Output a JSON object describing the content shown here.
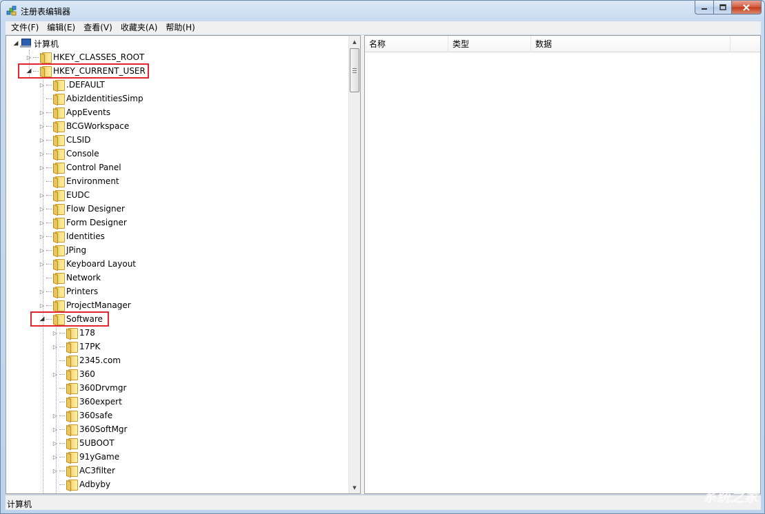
{
  "window": {
    "title": "注册表编辑器"
  },
  "menubar": {
    "items": [
      "文件(F)",
      "编辑(E)",
      "查看(V)",
      "收藏夹(A)",
      "帮助(H)"
    ]
  },
  "tree": {
    "root": "计算机",
    "hkcr": "HKEY_CLASSES_ROOT",
    "hkcu": "HKEY_CURRENT_USER",
    "hkcu_children": [
      ".DEFAULT",
      "AbizIdentitiesSimp",
      "AppEvents",
      "BCGWorkspace",
      "CLSID",
      "Console",
      "Control Panel",
      "Environment",
      "EUDC",
      "Flow Designer",
      "Form Designer",
      "Identities",
      "JPing",
      "Keyboard Layout",
      "Network",
      "Printers",
      "ProjectManager",
      "Software"
    ],
    "software_children": [
      "178",
      "17PK",
      "2345.com",
      "360",
      "360Drvmgr",
      "360expert",
      "360safe",
      "360SoftMgr",
      "5UBOOT",
      "91yGame",
      "AC3filter",
      "Adbyby"
    ]
  },
  "list": {
    "columns": [
      "名称",
      "类型",
      "数据"
    ]
  },
  "statusbar": {
    "path": "计算机"
  },
  "watermark": {
    "text": "系统之家"
  },
  "colors": {
    "highlight": "#e0262c",
    "folder": "#f6df85"
  }
}
